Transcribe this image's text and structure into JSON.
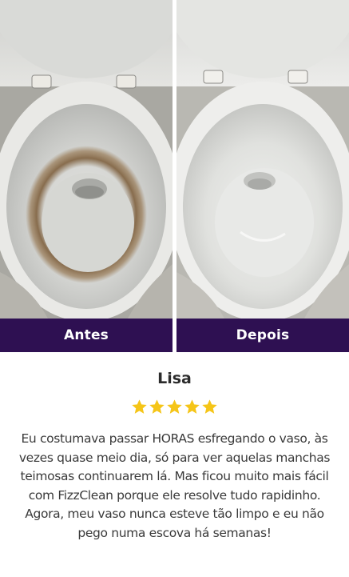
{
  "comparison": {
    "before_label": "Antes",
    "after_label": "Depois"
  },
  "review": {
    "name": "Lisa",
    "rating": 5,
    "rating_max": 5,
    "star_color": "#f5c518",
    "text": "Eu costumava passar HORAS esfregando o vaso, às vezes quase meio dia, só para ver aquelas manchas teimosas continuarem lá. Mas ficou muito mais fácil com FizzClean porque ele resolve tudo rapidinho. Agora, meu vaso nunca esteve tão limpo e eu não pego numa escova há semanas!"
  },
  "colors": {
    "label_bar": "#2e1052"
  }
}
